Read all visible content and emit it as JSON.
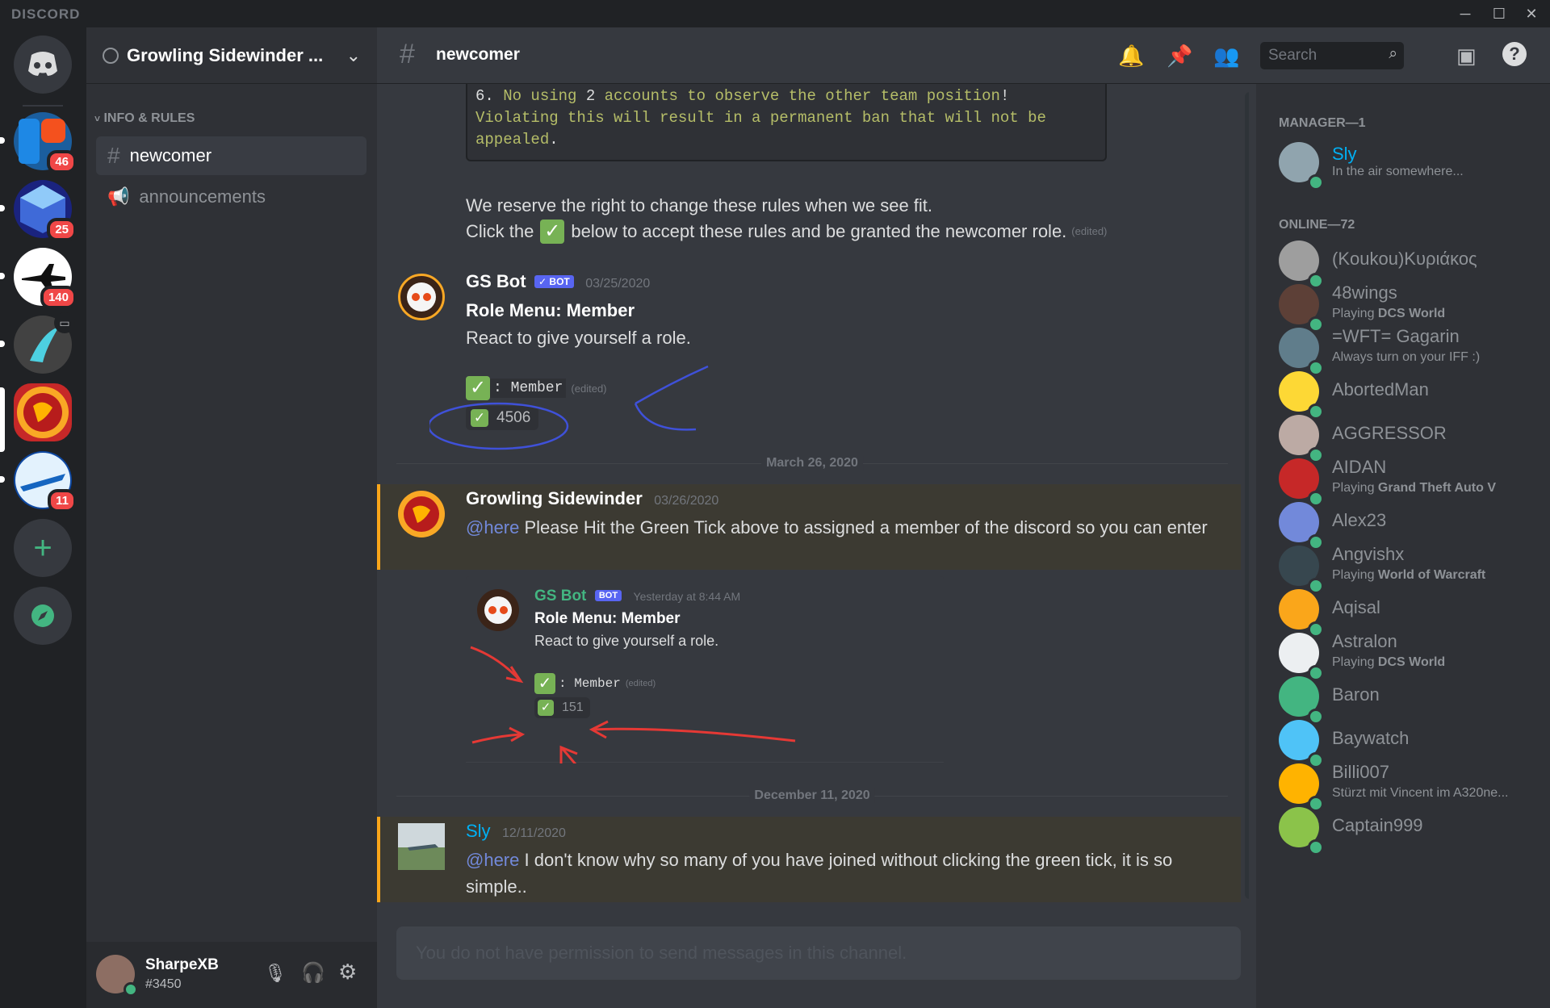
{
  "app": {
    "brand": "DISCORD"
  },
  "servers": [
    {
      "badge": "46"
    },
    {
      "badge": "25"
    },
    {
      "badge": "140"
    },
    {
      "badge": ""
    },
    {
      "badge": ""
    },
    {
      "badge": "11"
    }
  ],
  "guild": {
    "name": "Growling Sidewinder ..."
  },
  "sidebar": {
    "category": "INFO & RULES",
    "channels": [
      {
        "name": "newcomer"
      },
      {
        "name": "announcements"
      }
    ]
  },
  "user": {
    "name": "SharpeXB",
    "tag": "#3450"
  },
  "header": {
    "hash": "#",
    "channel": "newcomer",
    "search_placeholder": "Search"
  },
  "code_block": {
    "line1_num": "6.",
    "line1_a": "No using",
    "line1_num2": "2",
    "line1_b": "accounts to observe the other team position",
    "line1_end": "!",
    "line2": "Violating this will result in a permanent ban that will not be",
    "line3": "appealed",
    "line3_end": "."
  },
  "rules_text": {
    "line1": "We reserve the right to change these rules when we see fit.",
    "line2_a": "Click the",
    "line2_b": "below to accept these rules and be granted the newcomer role.",
    "edited": "(edited)"
  },
  "bot_msg": {
    "author": "GS Bot",
    "badge": "✓ BOT",
    "timestamp": "03/25/2020",
    "title": "Role Menu: Member",
    "body": "React to give yourself a role.",
    "role_label": ": Member",
    "edited": "(edited)",
    "reaction_count": "4506"
  },
  "divider1": "March 26, 2020",
  "owner_msg": {
    "author": "Growling Sidewinder",
    "timestamp": "03/26/2020",
    "mention": "@here",
    "text": "Please Hit the Green Tick above to assigned a member of the discord so you can enter"
  },
  "embed_image": {
    "author": "GS Bot",
    "badge": "BOT",
    "timestamp": "Yesterday at 8:44 AM",
    "title": "Role Menu: Member",
    "body": "React to give yourself a role.",
    "role_label": ": Member",
    "edited": "(edited)",
    "reaction_count": "151"
  },
  "divider2": "December 11, 2020",
  "sly_msg": {
    "author": "Sly",
    "timestamp": "12/11/2020",
    "mention": "@here",
    "text": "I don't know why so many of you have joined without clicking the green tick, it is so simple.."
  },
  "composer": {
    "placeholder": "You do not have permission to send messages in this channel."
  },
  "members": {
    "manager_header": "MANAGER—1",
    "manager": [
      {
        "name": "Sly",
        "activity": "In the air somewhere..."
      }
    ],
    "online_header": "ONLINE—72",
    "online": [
      {
        "name": "(Koukou)Κυριάκος",
        "act_prefix": "",
        "act_game": ""
      },
      {
        "name": "48wings",
        "act_prefix": "Playing ",
        "act_game": "DCS World"
      },
      {
        "name": "=WFT= Gagarin",
        "act_prefix": "Always turn on your IFF :)",
        "act_game": ""
      },
      {
        "name": "AbortedMan",
        "act_prefix": "",
        "act_game": ""
      },
      {
        "name": "AGGRESSOR",
        "act_prefix": "",
        "act_game": ""
      },
      {
        "name": "AIDAN",
        "act_prefix": "Playing ",
        "act_game": "Grand Theft Auto V"
      },
      {
        "name": "Alex23",
        "act_prefix": "",
        "act_game": ""
      },
      {
        "name": "Angvishx",
        "act_prefix": "Playing ",
        "act_game": "World of Warcraft"
      },
      {
        "name": "Aqisal",
        "act_prefix": "",
        "act_game": ""
      },
      {
        "name": "Astralon",
        "act_prefix": "Playing ",
        "act_game": "DCS World"
      },
      {
        "name": "Baron",
        "act_prefix": "",
        "act_game": ""
      },
      {
        "name": "Baywatch",
        "act_prefix": "",
        "act_game": ""
      },
      {
        "name": "Billi007",
        "act_prefix": "Stürzt mit Vincent im A320ne...",
        "act_game": ""
      },
      {
        "name": "Captain999",
        "act_prefix": "",
        "act_game": ""
      }
    ]
  },
  "colors": {
    "bg": "#36393f",
    "sidebar": "#2f3136",
    "rail": "#202225",
    "accent": "#5865f2",
    "online": "#43b581",
    "mention_bar": "#faa61a",
    "bot_green": "#43b581",
    "sly_blue": "#00b0f4"
  }
}
